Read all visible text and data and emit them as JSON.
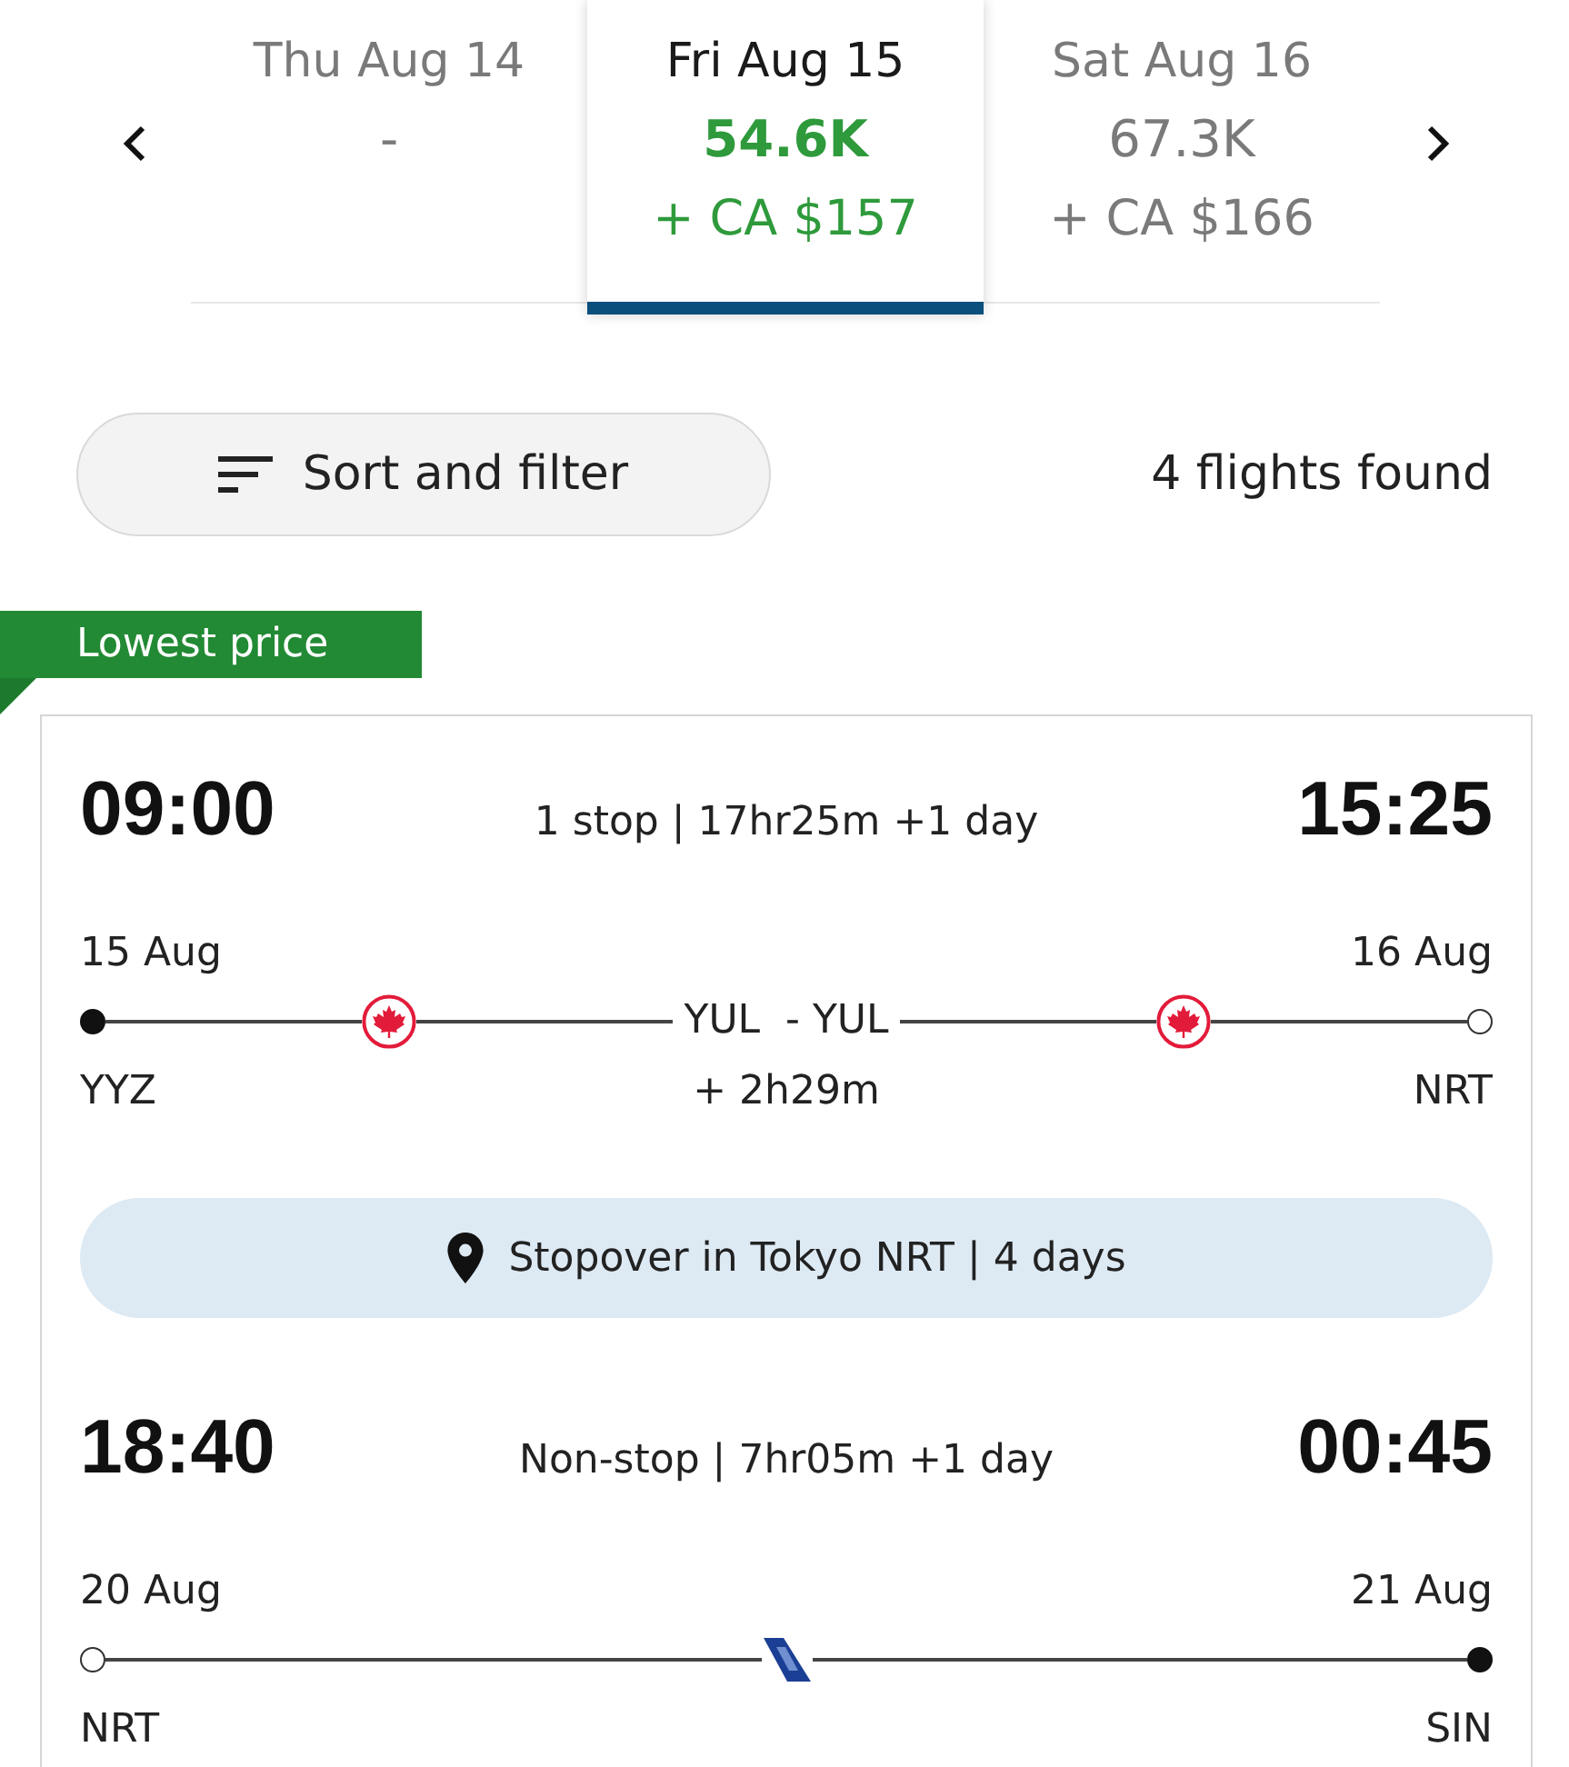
{
  "date_tabs": [
    {
      "date": "Thu Aug 14",
      "points": "-",
      "selected": false
    },
    {
      "date": "Fri Aug 15",
      "points": "54.6K",
      "price": "+ CA $157",
      "selected": true
    },
    {
      "date": "Sat Aug 16",
      "points": "67.3K",
      "price": "+ CA $166",
      "selected": false
    }
  ],
  "toolbar": {
    "sort_button": "Sort and filter",
    "result_count": "4 flights found"
  },
  "flights": [
    {
      "badge": "Lowest price",
      "parts": [
        {
          "kind": "leg",
          "depart_time": "09:00",
          "summary": "1 stop | 17hr25m +1 day",
          "arrive_time": "15:25",
          "depart_date": "15 Aug",
          "arrive_date": "16 Aug",
          "origin": "YYZ",
          "origin_filled": true,
          "destination": "NRT",
          "destination_filled": false,
          "track": [
            {
              "kind": "leaf"
            },
            {
              "kind": "connection",
              "airports": "YUL  - YUL",
              "layover": "+ 2h29m"
            },
            {
              "kind": "leaf"
            }
          ]
        },
        {
          "kind": "stopover",
          "text": "Stopover in Tokyo NRT | 4 days"
        },
        {
          "kind": "leg",
          "depart_time": "18:40",
          "summary": "Non-stop | 7hr05m +1 day",
          "arrive_time": "00:45",
          "depart_date": "20 Aug",
          "arrive_date": "21 Aug",
          "origin": "NRT",
          "origin_filled": false,
          "destination": "SIN",
          "destination_filled": true,
          "track": [
            {
              "kind": "tail"
            }
          ]
        }
      ]
    }
  ]
}
